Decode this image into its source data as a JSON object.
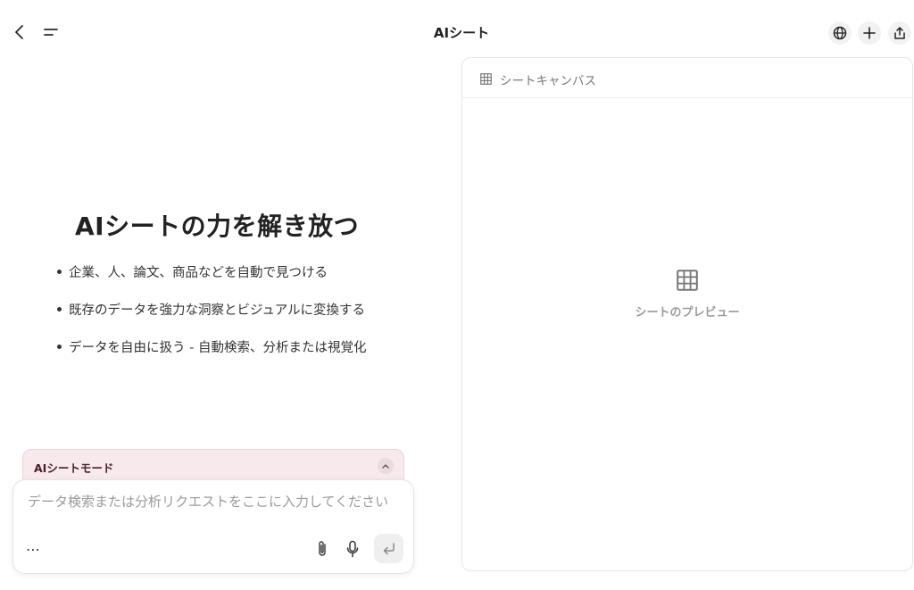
{
  "app": {
    "title": "AIシート"
  },
  "hero": {
    "title": "AIシートの力を解き放つ",
    "bullets": [
      "企業、人、論文、商品などを自動で見つける",
      "既存のデータを強力な洞察とビジュアルに変換する",
      "データを自由に扱う - 自動検索、分析または視覚化"
    ]
  },
  "mode": {
    "label": "AIシートモード"
  },
  "composer": {
    "placeholder": "データ検索または分析リクエストをここに入力してください",
    "more": "⋯"
  },
  "canvas": {
    "header": "シートキャンバス",
    "preview_label": "シートのプレビュー"
  },
  "icons": {
    "back": "chevron-left-icon",
    "menu": "menu-icon",
    "globe": "globe-icon",
    "plus": "plus-icon",
    "share": "share-icon",
    "collapse": "chevron-up-icon",
    "attach": "paperclip-icon",
    "mic": "microphone-icon",
    "send": "enter-icon",
    "grid": "table-icon"
  },
  "colors": {
    "mode_bg": "#f7e9ec",
    "mode_text": "#4a1f2a"
  }
}
